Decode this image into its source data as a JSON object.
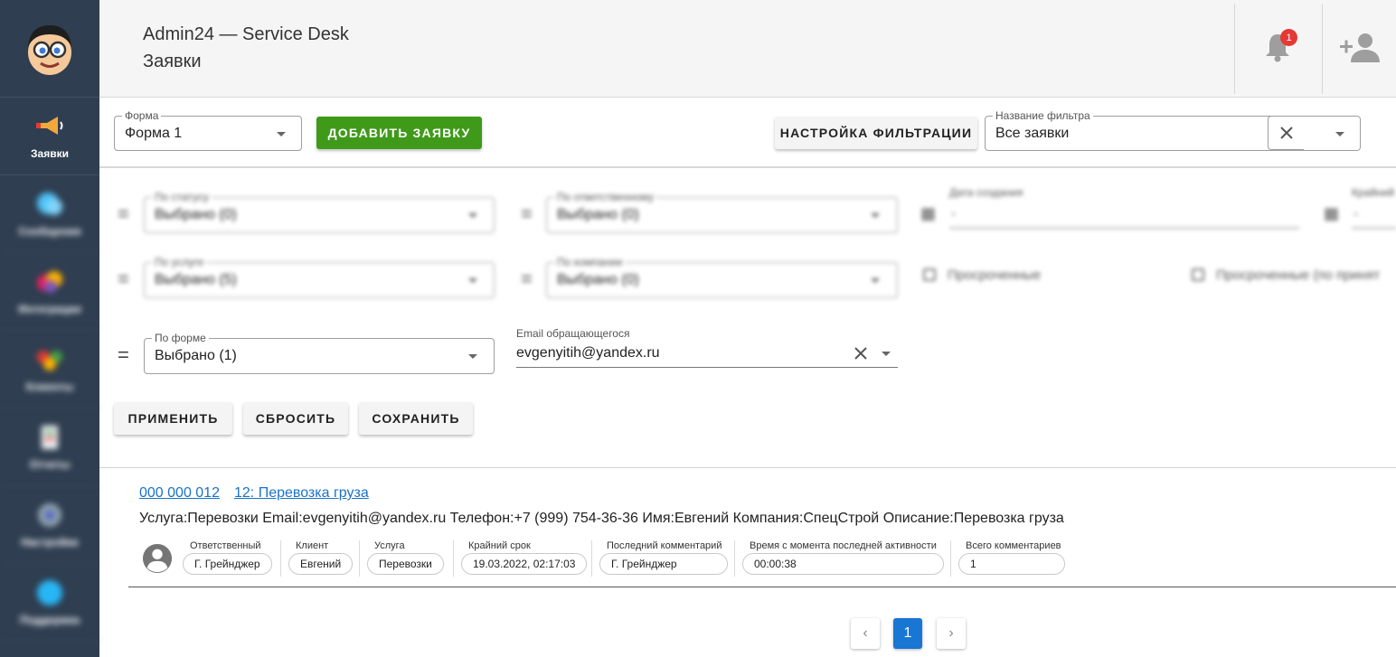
{
  "header": {
    "title": "Admin24 — Service Desk",
    "subtitle": "Заявки",
    "notifications": "1"
  },
  "sidebar": {
    "items": [
      {
        "label": "Заявки",
        "icon": "megaphone-icon"
      },
      {
        "label": "Сообщения",
        "icon": "chat-icon"
      },
      {
        "label": "Интеграции",
        "icon": "integration-icon"
      },
      {
        "label": "Клиенты",
        "icon": "clients-icon"
      },
      {
        "label": "Отчеты",
        "icon": "report-icon"
      },
      {
        "label": "Настройки",
        "icon": "settings-icon"
      },
      {
        "label": "Поддержка",
        "icon": "support-icon"
      }
    ]
  },
  "toolbar": {
    "form_label": "Форма",
    "form_value": "Форма 1",
    "add_button": "ДОБАВИТЬ ЗАЯВКУ",
    "filter_settings_button": "НАСТРОЙКА ФИЛЬТРАЦИИ",
    "filter_name_label": "Название фильтра",
    "filter_name_value": "Все заявки"
  },
  "filters": {
    "status_label": "По статусу",
    "status_value": "Выбрано (0)",
    "responsible_label": "По ответственному",
    "responsible_value": "Выбрано (0)",
    "created_label": "Дата создания",
    "created_value": "-",
    "deadline_label": "Крайний",
    "deadline_value": "-",
    "service_label": "По услуге",
    "service_value": "Выбрано (5)",
    "company_label": "По компании",
    "company_value": "Выбрано (0)",
    "overdue_label": "Просроченные",
    "overdue_accept_label": "Просроченные (по принят",
    "form_label": "По форме",
    "form_value": "Выбрано (1)",
    "email_label": "Email обращающегося",
    "email_value": "evgenyitih@yandex.ru",
    "apply_button": "ПРИМЕНИТЬ",
    "reset_button": "СБРОСИТЬ",
    "save_button": "СОХРАНИТЬ"
  },
  "ticket": {
    "number": "000 000 012",
    "title": "12: Перевозка груза",
    "description": "Услуга:Перевозки Email:evgenyitih@yandex.ru Телефон:+7 (999) 754-36-36 Имя:Евгений Компания:СпецСтрой Описание:Перевозка груза",
    "fields": [
      {
        "label": "Ответственный",
        "value": "Г. Грейнджер"
      },
      {
        "label": "Клиент",
        "value": "Евгений"
      },
      {
        "label": "Услуга",
        "value": "Перевозки"
      },
      {
        "label": "Крайний срок",
        "value": "19.03.2022, 02:17:03"
      },
      {
        "label": "Последний комментарий",
        "value": "Г. Грейнджер"
      },
      {
        "label": "Время с момента последней активности",
        "value": "00:00:38"
      },
      {
        "label": "Всего комментариев",
        "value": "1"
      }
    ]
  },
  "pagination": {
    "prev": "‹",
    "current": "1",
    "next": "›"
  },
  "colors": {
    "sidebar": "#2f3e51",
    "accent_green": "#3f9a1a",
    "link": "#1a73c9",
    "badge": "#e53935",
    "page_active": "#1976d2"
  }
}
